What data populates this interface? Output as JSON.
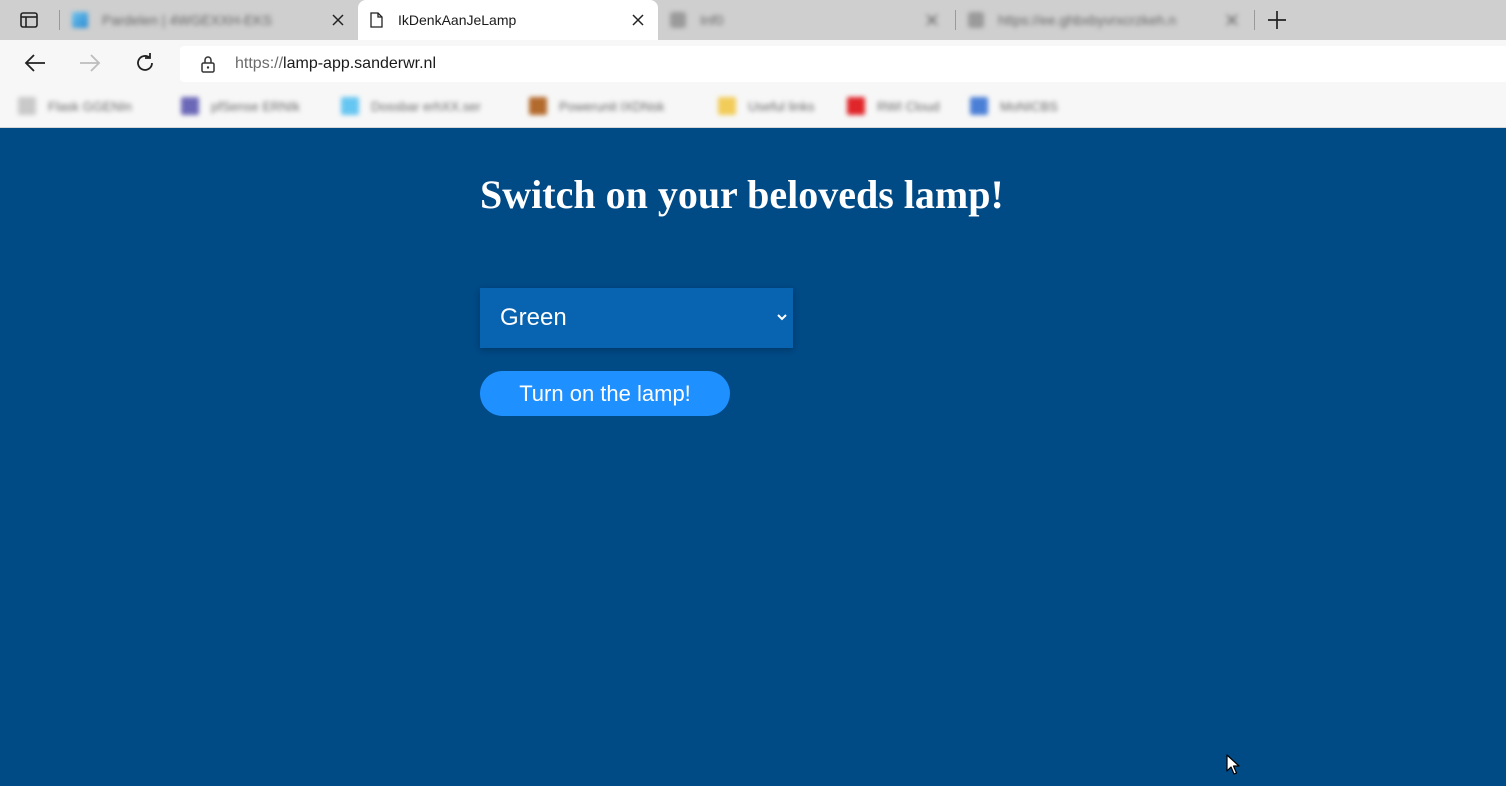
{
  "browser": {
    "tabs": [
      {
        "title": "Pardelen | 4WGEXXH-EKS",
        "state": "inactive",
        "blurred": true,
        "favicon": "app-icon"
      },
      {
        "title": "IkDenkAanJeLamp",
        "state": "active",
        "blurred": false,
        "favicon": "page-document-icon"
      },
      {
        "title": "Inf0",
        "state": "inactive",
        "blurred": true,
        "favicon": "page-document-icon"
      },
      {
        "title": "https://ee.ghbxbyvrxcrzkeh.n",
        "state": "inactive",
        "blurred": true,
        "favicon": "page-document-icon"
      }
    ],
    "address": {
      "scheme": "https://",
      "host": "lamp-app.sanderwr.nl"
    },
    "bookmarks": [
      {
        "label": "Flask GGENIn",
        "color": "#c9c9c9"
      },
      {
        "label": "pfSense ERNIk",
        "color": "#6c68b8"
      },
      {
        "label": "Dossbar erhXX.ser",
        "color": "#66c6f2"
      },
      {
        "label": "Powerunit IXDNsk",
        "color": "#b36a2d"
      },
      {
        "label": "Useful links",
        "color": "#f2cc59"
      },
      {
        "label": "RWI Cloud",
        "color": "#e0262a"
      },
      {
        "label": "MoNICBS",
        "color": "#4b7fd6"
      }
    ]
  },
  "page": {
    "title": "Switch on your beloveds lamp!",
    "color_select": {
      "selected": "Green"
    },
    "button_label": "Turn on the lamp!"
  },
  "colors": {
    "background": "#004a86",
    "select_bg": "#0863b0",
    "button_bg": "#1e90ff",
    "text": "#ffffff"
  }
}
